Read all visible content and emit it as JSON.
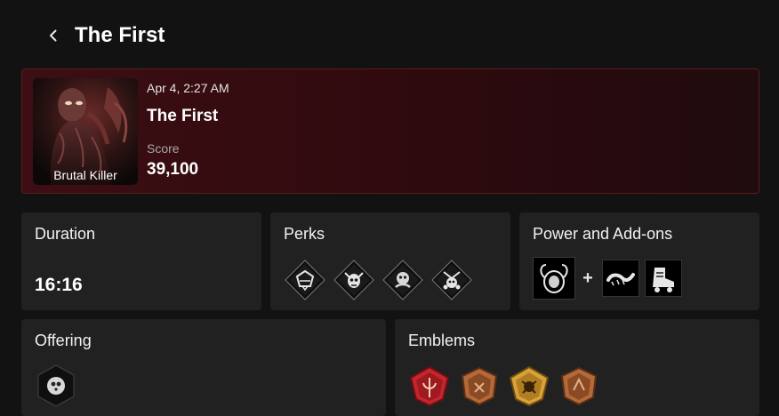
{
  "header": {
    "back_icon": "chevron-left-icon",
    "title": "The First"
  },
  "match": {
    "date": "Apr 4, 2:27 AM",
    "name": "The First",
    "score_label": "Score",
    "score": "39,100",
    "portrait_caption": "Brutal Killer"
  },
  "panels": {
    "duration": {
      "title": "Duration",
      "value": "16:16"
    },
    "perks": {
      "title": "Perks",
      "icons": [
        "perk-icon",
        "perk-icon",
        "perk-icon",
        "perk-icon"
      ]
    },
    "power": {
      "title": "Power and Add-ons",
      "plus": "+",
      "icons": [
        "power-icon",
        "addon-icon",
        "addon-icon"
      ]
    },
    "offering": {
      "title": "Offering",
      "icon": "offering-icon"
    },
    "emblems": {
      "title": "Emblems",
      "icons": [
        "emblem-iridescent-icon",
        "emblem-bronze-icon",
        "emblem-gold-icon",
        "emblem-bronze-icon"
      ]
    }
  },
  "colors": {
    "background": "#121212",
    "panel": "#212121",
    "card_accent": "#3d0e13",
    "card_border": "#5a1a1e",
    "emblem_bronze": "#b4693a",
    "emblem_gold": "#d8a23a",
    "emblem_iridescent": "#c8242c"
  }
}
